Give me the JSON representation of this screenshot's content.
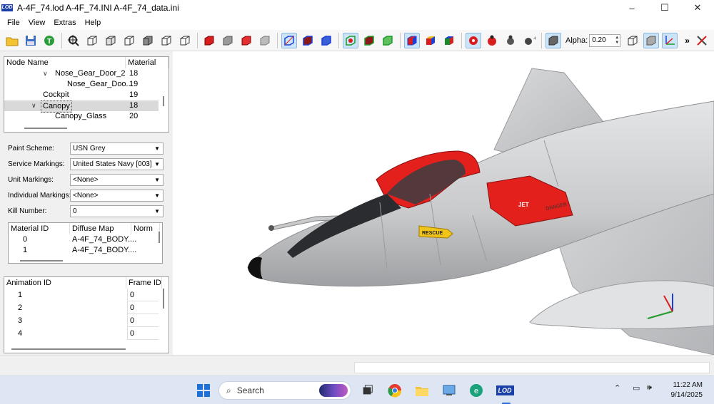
{
  "window": {
    "title": "A-4F_74.lod  A-4F_74.INI  A-4F_74_data.ini",
    "app_icon_text": "LOD",
    "minimize": "–",
    "maximize": "☐",
    "close": "✕"
  },
  "menu": {
    "items": [
      "File",
      "View",
      "Extras",
      "Help"
    ]
  },
  "toolbar": {
    "alpha_label": "Alpha:",
    "alpha_value": "0.20",
    "more": "»",
    "accent": "#1a3fa8"
  },
  "node_tree": {
    "headers": [
      "Node Name",
      "Material"
    ],
    "rows": [
      {
        "name": "Nose_Gear_Door_2",
        "material": "18",
        "expander": "∨"
      },
      {
        "name": "Nose_Gear_Doo...",
        "material": "19",
        "expander": ""
      },
      {
        "name": "Cockpit",
        "material": "19",
        "expander": ""
      },
      {
        "name": "Canopy",
        "material": "18",
        "expander": "∨",
        "selected": true
      },
      {
        "name": "Canopy_Glass",
        "material": "20",
        "expander": ""
      }
    ]
  },
  "properties": [
    {
      "label": "Paint Scheme:",
      "value": "USN Grey"
    },
    {
      "label": "Service Markings:",
      "value": "United States Navy [003]"
    },
    {
      "label": "Unit Markings:",
      "value": "<None>"
    },
    {
      "label": "Individual Markings:",
      "value": "<None>"
    },
    {
      "label": "Kill Number:",
      "value": "0"
    }
  ],
  "material_table": {
    "headers": [
      "Material ID",
      "Diffuse Map",
      "Norm"
    ],
    "rows": [
      {
        "id": "0",
        "diffuse": "A-4F_74_BODY...."
      },
      {
        "id": "1",
        "diffuse": "A-4F_74_BODY...."
      }
    ]
  },
  "animation_table": {
    "headers": [
      "Animation ID",
      "Frame ID"
    ],
    "rows": [
      {
        "id": "1",
        "frame": "0"
      },
      {
        "id": "2",
        "frame": "0"
      },
      {
        "id": "3",
        "frame": "0"
      },
      {
        "id": "4",
        "frame": "0"
      }
    ]
  },
  "viewport": {
    "decals": {
      "rescue": "RESCUE",
      "jet": "JET",
      "danger": "DANGER"
    },
    "fuselage_color": "#cfd0d2",
    "accent_red": "#e3201b"
  },
  "taskbar": {
    "search_placeholder": "Search",
    "time": "11:22 AM",
    "date": "9/14/2025",
    "lod_label": "LOD"
  }
}
